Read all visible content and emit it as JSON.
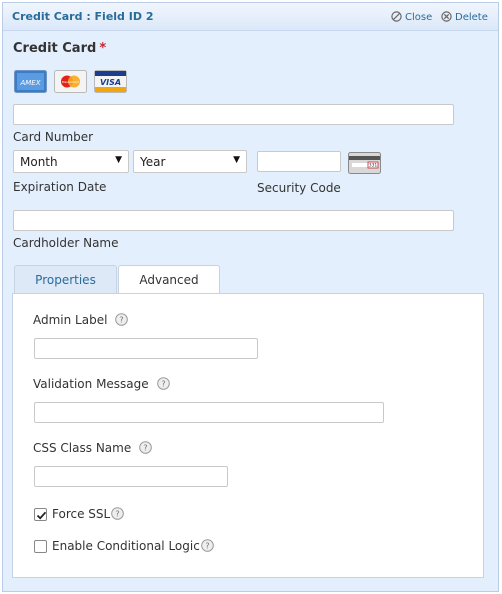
{
  "header": {
    "title": "Credit Card : Field ID 2",
    "close_label": "Close",
    "delete_label": "Delete"
  },
  "field": {
    "label": "Credit Card",
    "required_mark": "*",
    "cards": [
      "AMEX",
      "MasterCard",
      "VISA"
    ],
    "card_number_label": "Card Number",
    "month_value": "Month",
    "year_value": "Year",
    "expiration_label": "Expiration Date",
    "security_label": "Security Code",
    "security_card_text": "331",
    "cardholder_label": "Cardholder Name"
  },
  "tabs": {
    "properties_label": "Properties",
    "advanced_label": "Advanced"
  },
  "advanced": {
    "admin_label": "Admin Label",
    "validation_label": "Validation Message",
    "css_label": "CSS Class Name",
    "force_ssl_label": "Force SSL",
    "force_ssl_checked": true,
    "conditional_label": "Enable Conditional Logic",
    "conditional_checked": false
  },
  "colors": {
    "panel_bg": "#e4effd",
    "title": "#2a6b9a",
    "required": "#c4262e"
  }
}
